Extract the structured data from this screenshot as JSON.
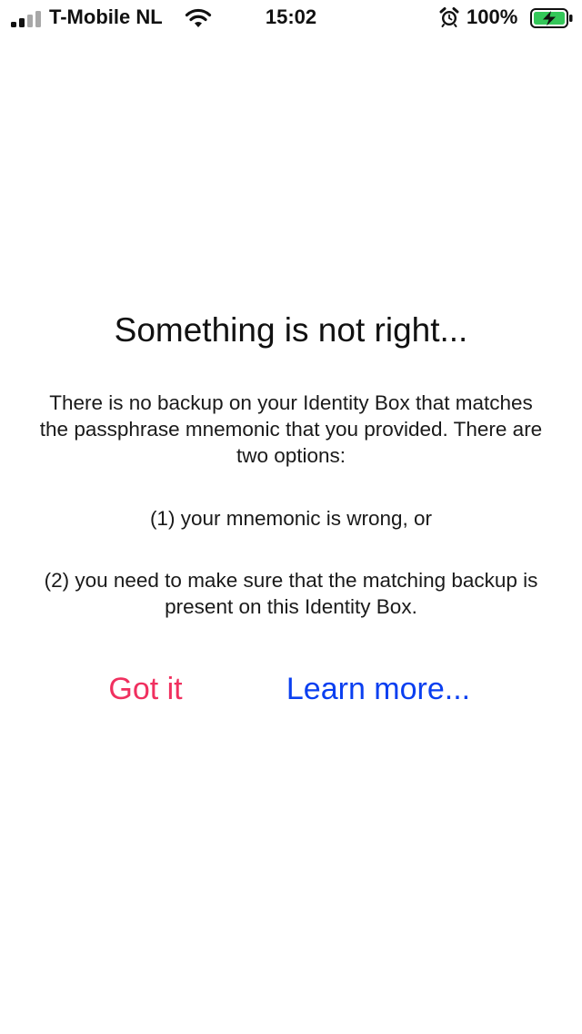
{
  "status_bar": {
    "carrier": "T-Mobile NL",
    "time": "15:02",
    "battery_percent": "100%",
    "icons": [
      "signal-icon",
      "wifi-icon",
      "alarm-icon",
      "battery-charging-icon"
    ],
    "battery_color": "#34c759"
  },
  "dialog": {
    "title": "Something is not right...",
    "paragraph_1": "There is no backup on your Identity Box that matches the passphrase mnemonic that you provided. There are two options:",
    "paragraph_2": "(1) your mnemonic is wrong, or",
    "paragraph_3": "(2) you need to make sure that the matching backup is present on this Identity Box.",
    "got_it_label": "Got it",
    "learn_more_label": "Learn more...",
    "got_it_color": "#f0305f",
    "learn_more_color": "#0a3ff0"
  }
}
